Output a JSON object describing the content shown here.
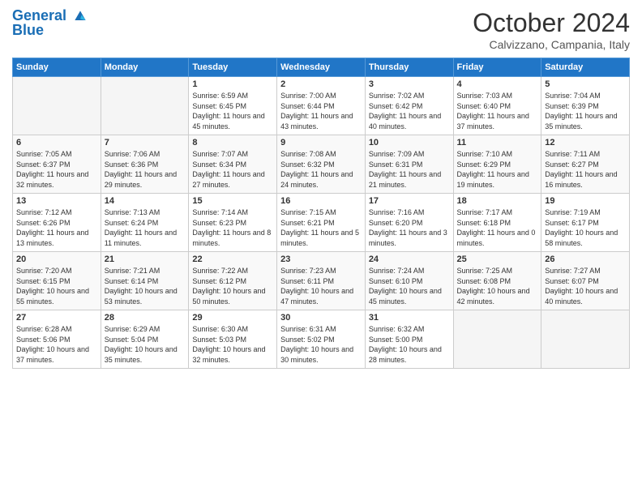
{
  "header": {
    "logo_line1": "General",
    "logo_line2": "Blue",
    "month_title": "October 2024",
    "location": "Calvizzano, Campania, Italy"
  },
  "days_of_week": [
    "Sunday",
    "Monday",
    "Tuesday",
    "Wednesday",
    "Thursday",
    "Friday",
    "Saturday"
  ],
  "weeks": [
    [
      {
        "num": "",
        "empty": true
      },
      {
        "num": "",
        "empty": true
      },
      {
        "num": "1",
        "sunrise": "Sunrise: 6:59 AM",
        "sunset": "Sunset: 6:45 PM",
        "daylight": "Daylight: 11 hours and 45 minutes."
      },
      {
        "num": "2",
        "sunrise": "Sunrise: 7:00 AM",
        "sunset": "Sunset: 6:44 PM",
        "daylight": "Daylight: 11 hours and 43 minutes."
      },
      {
        "num": "3",
        "sunrise": "Sunrise: 7:02 AM",
        "sunset": "Sunset: 6:42 PM",
        "daylight": "Daylight: 11 hours and 40 minutes."
      },
      {
        "num": "4",
        "sunrise": "Sunrise: 7:03 AM",
        "sunset": "Sunset: 6:40 PM",
        "daylight": "Daylight: 11 hours and 37 minutes."
      },
      {
        "num": "5",
        "sunrise": "Sunrise: 7:04 AM",
        "sunset": "Sunset: 6:39 PM",
        "daylight": "Daylight: 11 hours and 35 minutes."
      }
    ],
    [
      {
        "num": "6",
        "sunrise": "Sunrise: 7:05 AM",
        "sunset": "Sunset: 6:37 PM",
        "daylight": "Daylight: 11 hours and 32 minutes."
      },
      {
        "num": "7",
        "sunrise": "Sunrise: 7:06 AM",
        "sunset": "Sunset: 6:36 PM",
        "daylight": "Daylight: 11 hours and 29 minutes."
      },
      {
        "num": "8",
        "sunrise": "Sunrise: 7:07 AM",
        "sunset": "Sunset: 6:34 PM",
        "daylight": "Daylight: 11 hours and 27 minutes."
      },
      {
        "num": "9",
        "sunrise": "Sunrise: 7:08 AM",
        "sunset": "Sunset: 6:32 PM",
        "daylight": "Daylight: 11 hours and 24 minutes."
      },
      {
        "num": "10",
        "sunrise": "Sunrise: 7:09 AM",
        "sunset": "Sunset: 6:31 PM",
        "daylight": "Daylight: 11 hours and 21 minutes."
      },
      {
        "num": "11",
        "sunrise": "Sunrise: 7:10 AM",
        "sunset": "Sunset: 6:29 PM",
        "daylight": "Daylight: 11 hours and 19 minutes."
      },
      {
        "num": "12",
        "sunrise": "Sunrise: 7:11 AM",
        "sunset": "Sunset: 6:27 PM",
        "daylight": "Daylight: 11 hours and 16 minutes."
      }
    ],
    [
      {
        "num": "13",
        "sunrise": "Sunrise: 7:12 AM",
        "sunset": "Sunset: 6:26 PM",
        "daylight": "Daylight: 11 hours and 13 minutes."
      },
      {
        "num": "14",
        "sunrise": "Sunrise: 7:13 AM",
        "sunset": "Sunset: 6:24 PM",
        "daylight": "Daylight: 11 hours and 11 minutes."
      },
      {
        "num": "15",
        "sunrise": "Sunrise: 7:14 AM",
        "sunset": "Sunset: 6:23 PM",
        "daylight": "Daylight: 11 hours and 8 minutes."
      },
      {
        "num": "16",
        "sunrise": "Sunrise: 7:15 AM",
        "sunset": "Sunset: 6:21 PM",
        "daylight": "Daylight: 11 hours and 5 minutes."
      },
      {
        "num": "17",
        "sunrise": "Sunrise: 7:16 AM",
        "sunset": "Sunset: 6:20 PM",
        "daylight": "Daylight: 11 hours and 3 minutes."
      },
      {
        "num": "18",
        "sunrise": "Sunrise: 7:17 AM",
        "sunset": "Sunset: 6:18 PM",
        "daylight": "Daylight: 11 hours and 0 minutes."
      },
      {
        "num": "19",
        "sunrise": "Sunrise: 7:19 AM",
        "sunset": "Sunset: 6:17 PM",
        "daylight": "Daylight: 10 hours and 58 minutes."
      }
    ],
    [
      {
        "num": "20",
        "sunrise": "Sunrise: 7:20 AM",
        "sunset": "Sunset: 6:15 PM",
        "daylight": "Daylight: 10 hours and 55 minutes."
      },
      {
        "num": "21",
        "sunrise": "Sunrise: 7:21 AM",
        "sunset": "Sunset: 6:14 PM",
        "daylight": "Daylight: 10 hours and 53 minutes."
      },
      {
        "num": "22",
        "sunrise": "Sunrise: 7:22 AM",
        "sunset": "Sunset: 6:12 PM",
        "daylight": "Daylight: 10 hours and 50 minutes."
      },
      {
        "num": "23",
        "sunrise": "Sunrise: 7:23 AM",
        "sunset": "Sunset: 6:11 PM",
        "daylight": "Daylight: 10 hours and 47 minutes."
      },
      {
        "num": "24",
        "sunrise": "Sunrise: 7:24 AM",
        "sunset": "Sunset: 6:10 PM",
        "daylight": "Daylight: 10 hours and 45 minutes."
      },
      {
        "num": "25",
        "sunrise": "Sunrise: 7:25 AM",
        "sunset": "Sunset: 6:08 PM",
        "daylight": "Daylight: 10 hours and 42 minutes."
      },
      {
        "num": "26",
        "sunrise": "Sunrise: 7:27 AM",
        "sunset": "Sunset: 6:07 PM",
        "daylight": "Daylight: 10 hours and 40 minutes."
      }
    ],
    [
      {
        "num": "27",
        "sunrise": "Sunrise: 6:28 AM",
        "sunset": "Sunset: 5:06 PM",
        "daylight": "Daylight: 10 hours and 37 minutes."
      },
      {
        "num": "28",
        "sunrise": "Sunrise: 6:29 AM",
        "sunset": "Sunset: 5:04 PM",
        "daylight": "Daylight: 10 hours and 35 minutes."
      },
      {
        "num": "29",
        "sunrise": "Sunrise: 6:30 AM",
        "sunset": "Sunset: 5:03 PM",
        "daylight": "Daylight: 10 hours and 32 minutes."
      },
      {
        "num": "30",
        "sunrise": "Sunrise: 6:31 AM",
        "sunset": "Sunset: 5:02 PM",
        "daylight": "Daylight: 10 hours and 30 minutes."
      },
      {
        "num": "31",
        "sunrise": "Sunrise: 6:32 AM",
        "sunset": "Sunset: 5:00 PM",
        "daylight": "Daylight: 10 hours and 28 minutes."
      },
      {
        "num": "",
        "empty": true
      },
      {
        "num": "",
        "empty": true
      }
    ]
  ]
}
